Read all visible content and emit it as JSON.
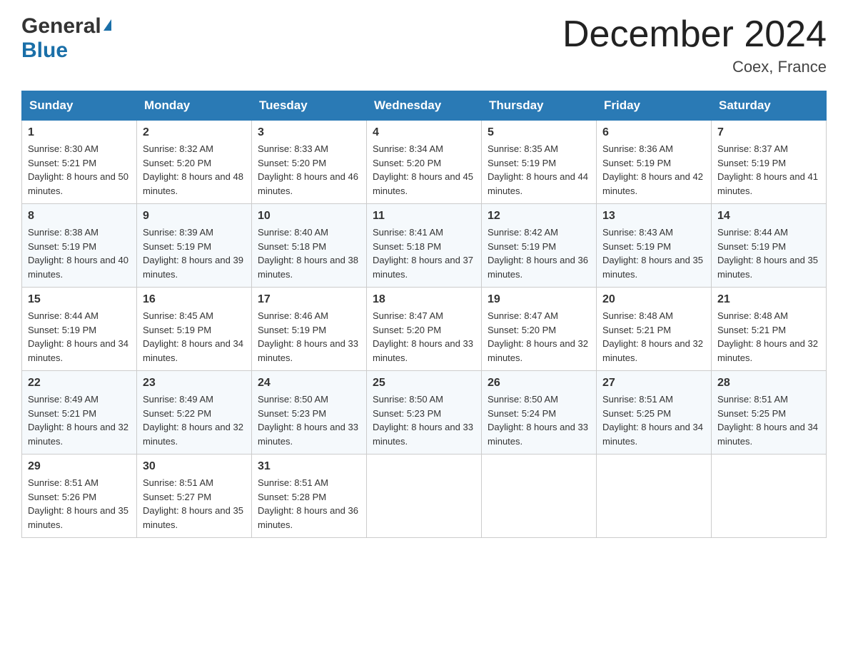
{
  "header": {
    "logo_general": "General",
    "logo_blue": "Blue",
    "month_title": "December 2024",
    "location": "Coex, France"
  },
  "days_of_week": [
    "Sunday",
    "Monday",
    "Tuesday",
    "Wednesday",
    "Thursday",
    "Friday",
    "Saturday"
  ],
  "weeks": [
    [
      {
        "day": "1",
        "sunrise": "8:30 AM",
        "sunset": "5:21 PM",
        "daylight": "8 hours and 50 minutes."
      },
      {
        "day": "2",
        "sunrise": "8:32 AM",
        "sunset": "5:20 PM",
        "daylight": "8 hours and 48 minutes."
      },
      {
        "day": "3",
        "sunrise": "8:33 AM",
        "sunset": "5:20 PM",
        "daylight": "8 hours and 46 minutes."
      },
      {
        "day": "4",
        "sunrise": "8:34 AM",
        "sunset": "5:20 PM",
        "daylight": "8 hours and 45 minutes."
      },
      {
        "day": "5",
        "sunrise": "8:35 AM",
        "sunset": "5:19 PM",
        "daylight": "8 hours and 44 minutes."
      },
      {
        "day": "6",
        "sunrise": "8:36 AM",
        "sunset": "5:19 PM",
        "daylight": "8 hours and 42 minutes."
      },
      {
        "day": "7",
        "sunrise": "8:37 AM",
        "sunset": "5:19 PM",
        "daylight": "8 hours and 41 minutes."
      }
    ],
    [
      {
        "day": "8",
        "sunrise": "8:38 AM",
        "sunset": "5:19 PM",
        "daylight": "8 hours and 40 minutes."
      },
      {
        "day": "9",
        "sunrise": "8:39 AM",
        "sunset": "5:19 PM",
        "daylight": "8 hours and 39 minutes."
      },
      {
        "day": "10",
        "sunrise": "8:40 AM",
        "sunset": "5:18 PM",
        "daylight": "8 hours and 38 minutes."
      },
      {
        "day": "11",
        "sunrise": "8:41 AM",
        "sunset": "5:18 PM",
        "daylight": "8 hours and 37 minutes."
      },
      {
        "day": "12",
        "sunrise": "8:42 AM",
        "sunset": "5:19 PM",
        "daylight": "8 hours and 36 minutes."
      },
      {
        "day": "13",
        "sunrise": "8:43 AM",
        "sunset": "5:19 PM",
        "daylight": "8 hours and 35 minutes."
      },
      {
        "day": "14",
        "sunrise": "8:44 AM",
        "sunset": "5:19 PM",
        "daylight": "8 hours and 35 minutes."
      }
    ],
    [
      {
        "day": "15",
        "sunrise": "8:44 AM",
        "sunset": "5:19 PM",
        "daylight": "8 hours and 34 minutes."
      },
      {
        "day": "16",
        "sunrise": "8:45 AM",
        "sunset": "5:19 PM",
        "daylight": "8 hours and 34 minutes."
      },
      {
        "day": "17",
        "sunrise": "8:46 AM",
        "sunset": "5:19 PM",
        "daylight": "8 hours and 33 minutes."
      },
      {
        "day": "18",
        "sunrise": "8:47 AM",
        "sunset": "5:20 PM",
        "daylight": "8 hours and 33 minutes."
      },
      {
        "day": "19",
        "sunrise": "8:47 AM",
        "sunset": "5:20 PM",
        "daylight": "8 hours and 32 minutes."
      },
      {
        "day": "20",
        "sunrise": "8:48 AM",
        "sunset": "5:21 PM",
        "daylight": "8 hours and 32 minutes."
      },
      {
        "day": "21",
        "sunrise": "8:48 AM",
        "sunset": "5:21 PM",
        "daylight": "8 hours and 32 minutes."
      }
    ],
    [
      {
        "day": "22",
        "sunrise": "8:49 AM",
        "sunset": "5:21 PM",
        "daylight": "8 hours and 32 minutes."
      },
      {
        "day": "23",
        "sunrise": "8:49 AM",
        "sunset": "5:22 PM",
        "daylight": "8 hours and 32 minutes."
      },
      {
        "day": "24",
        "sunrise": "8:50 AM",
        "sunset": "5:23 PM",
        "daylight": "8 hours and 33 minutes."
      },
      {
        "day": "25",
        "sunrise": "8:50 AM",
        "sunset": "5:23 PM",
        "daylight": "8 hours and 33 minutes."
      },
      {
        "day": "26",
        "sunrise": "8:50 AM",
        "sunset": "5:24 PM",
        "daylight": "8 hours and 33 minutes."
      },
      {
        "day": "27",
        "sunrise": "8:51 AM",
        "sunset": "5:25 PM",
        "daylight": "8 hours and 34 minutes."
      },
      {
        "day": "28",
        "sunrise": "8:51 AM",
        "sunset": "5:25 PM",
        "daylight": "8 hours and 34 minutes."
      }
    ],
    [
      {
        "day": "29",
        "sunrise": "8:51 AM",
        "sunset": "5:26 PM",
        "daylight": "8 hours and 35 minutes."
      },
      {
        "day": "30",
        "sunrise": "8:51 AM",
        "sunset": "5:27 PM",
        "daylight": "8 hours and 35 minutes."
      },
      {
        "day": "31",
        "sunrise": "8:51 AM",
        "sunset": "5:28 PM",
        "daylight": "8 hours and 36 minutes."
      },
      null,
      null,
      null,
      null
    ]
  ],
  "labels": {
    "sunrise": "Sunrise: ",
    "sunset": "Sunset: ",
    "daylight": "Daylight: "
  }
}
